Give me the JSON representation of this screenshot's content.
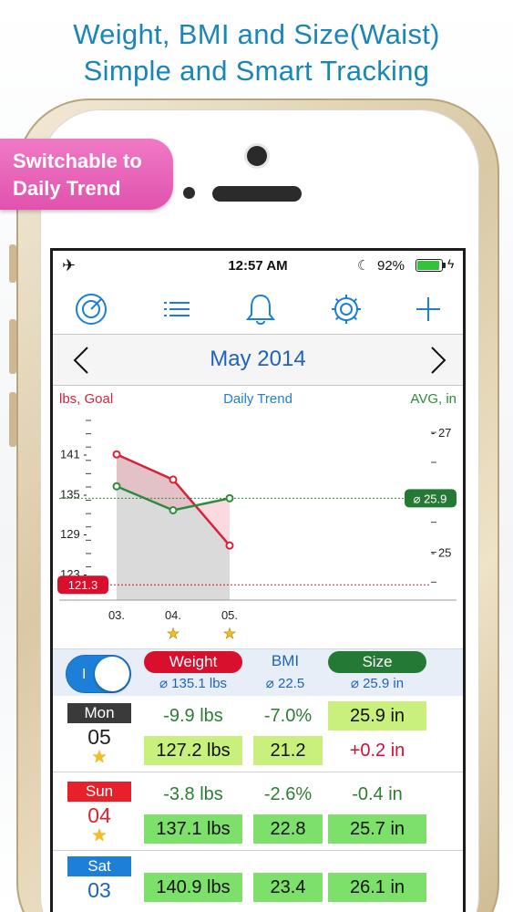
{
  "promo": {
    "title_line1": "Weight, BMI and Size(Waist)",
    "title_line2": "Simple and Smart Tracking",
    "ribbon_line1": "Switchable to",
    "ribbon_line2": "Daily Trend"
  },
  "status": {
    "time": "12:57 AM",
    "battery": "92%",
    "battery_level": 0.92
  },
  "toolbar": {
    "icons": [
      "chart-ring-icon",
      "list-icon",
      "bell-icon",
      "gear-icon",
      "plus-icon"
    ]
  },
  "header": {
    "month": "May 2014"
  },
  "chart": {
    "left_label": "lbs, Goal",
    "center_label": "Daily Trend",
    "right_label": "AVG, in",
    "goal_value": "121.3",
    "avg_value": "⌀ 25.9",
    "left_ticks": [
      "141",
      "135",
      "129",
      "123"
    ],
    "right_ticks": [
      "27",
      "25"
    ],
    "x_labels": [
      "03.",
      "04.",
      "05."
    ]
  },
  "chart_data": {
    "type": "line",
    "categories": [
      "03.",
      "04.",
      "05."
    ],
    "title": "Daily Trend",
    "series": [
      {
        "name": "Weight",
        "axis": "left",
        "values": [
          140.9,
          137.1,
          127.2
        ],
        "color": "#d8223a"
      },
      {
        "name": "Size",
        "axis": "right",
        "values": [
          26.1,
          25.7,
          25.9
        ],
        "color": "#2e8b3d"
      }
    ],
    "goal": 121.3,
    "avg_size": 25.9,
    "ylim_left": [
      119,
      146
    ],
    "ylim_right": [
      24.2,
      27.2
    ],
    "starred": [
      "04.",
      "05."
    ]
  },
  "legend": {
    "toggle_label": "I",
    "weight_label": "Weight",
    "weight_avg": "⌀ 135.1 lbs",
    "bmi_label": "BMI",
    "bmi_avg": "⌀ 22.5",
    "size_label": "Size",
    "size_avg": "⌀ 25.9 in"
  },
  "days": [
    {
      "label": "Mon",
      "label_color": "#3a3a3a",
      "num": "05",
      "num_color": "#222222",
      "star": true,
      "delta_weight": "-9.9 lbs",
      "delta_bmi": "-7.0%",
      "size": "25.9 in",
      "weight": "127.2 lbs",
      "bmi": "21.2",
      "delta_size": "+0.2 in"
    },
    {
      "label": "Sun",
      "label_color": "#e8202a",
      "num": "04",
      "num_color": "#e8202a",
      "star": true,
      "delta_weight": "-3.8 lbs",
      "delta_bmi": "-2.6%",
      "delta_size": "-0.4 in",
      "weight": "137.1 lbs",
      "bmi": "22.8",
      "size": "25.7 in"
    },
    {
      "label": "Sat",
      "label_color": "#1e7fd8",
      "num": "03",
      "num_color": "#1e63b8",
      "star": false,
      "weight": "140.9 lbs",
      "bmi": "23.4",
      "size": "26.1 in"
    }
  ]
}
